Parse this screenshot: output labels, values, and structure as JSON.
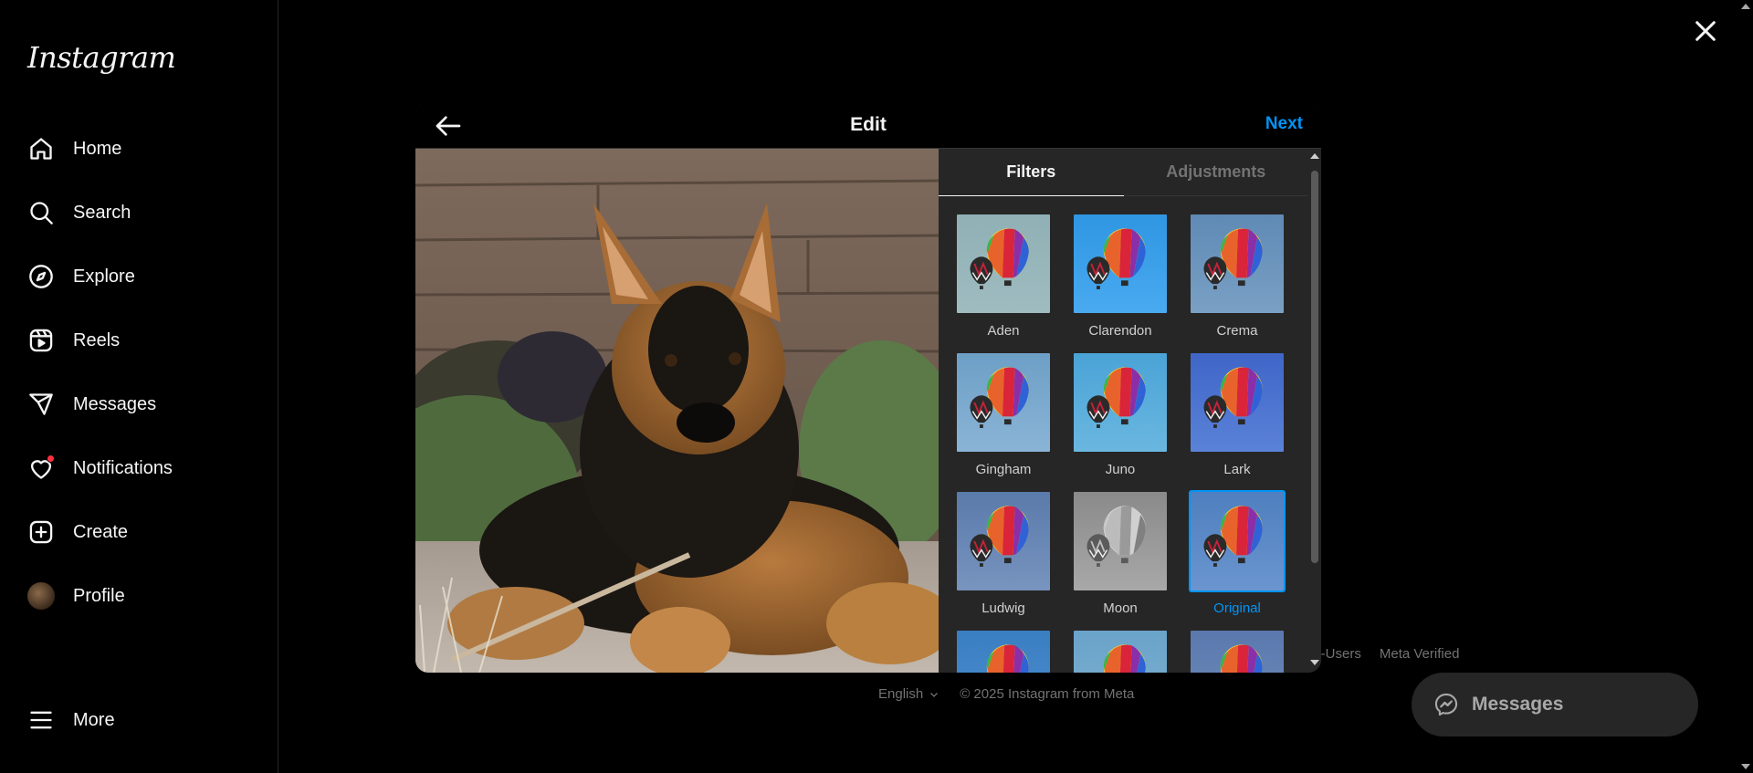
{
  "app": {
    "logo_text": "Instagram"
  },
  "sidebar": {
    "items": [
      {
        "label": "Home",
        "icon": "home-icon"
      },
      {
        "label": "Search",
        "icon": "search-icon"
      },
      {
        "label": "Explore",
        "icon": "compass-icon"
      },
      {
        "label": "Reels",
        "icon": "reels-icon"
      },
      {
        "label": "Messages",
        "icon": "paper-plane-icon"
      },
      {
        "label": "Notifications",
        "icon": "heart-icon"
      },
      {
        "label": "Create",
        "icon": "plus-square-icon"
      },
      {
        "label": "Profile",
        "icon": "avatar"
      }
    ],
    "more_label": "More"
  },
  "modal": {
    "title": "Edit",
    "next_label": "Next",
    "tabs": [
      {
        "label": "Filters",
        "active": true
      },
      {
        "label": "Adjustments",
        "active": false
      }
    ],
    "filters": [
      {
        "name": "Aden",
        "tint": "aden"
      },
      {
        "name": "Clarendon",
        "tint": "clarendon"
      },
      {
        "name": "Crema",
        "tint": "crema"
      },
      {
        "name": "Gingham",
        "tint": "gingham"
      },
      {
        "name": "Juno",
        "tint": "juno"
      },
      {
        "name": "Lark",
        "tint": "lark"
      },
      {
        "name": "Ludwig",
        "tint": "ludwig"
      },
      {
        "name": "Moon",
        "tint": "moon"
      },
      {
        "name": "Original",
        "tint": "original",
        "selected": true
      },
      {
        "name": "",
        "tint": "partial1"
      },
      {
        "name": "",
        "tint": "partial2"
      },
      {
        "name": "",
        "tint": "partial3"
      }
    ]
  },
  "footer": {
    "links": [
      "on-Users",
      "Meta Verified"
    ],
    "language": "English",
    "copyright": "© 2025 Instagram from Meta"
  },
  "messages_pill": {
    "label": "Messages"
  },
  "colors": {
    "accent": "#0095f6",
    "notification": "#ff3040",
    "background": "#000000",
    "modal_bg": "#262626"
  }
}
